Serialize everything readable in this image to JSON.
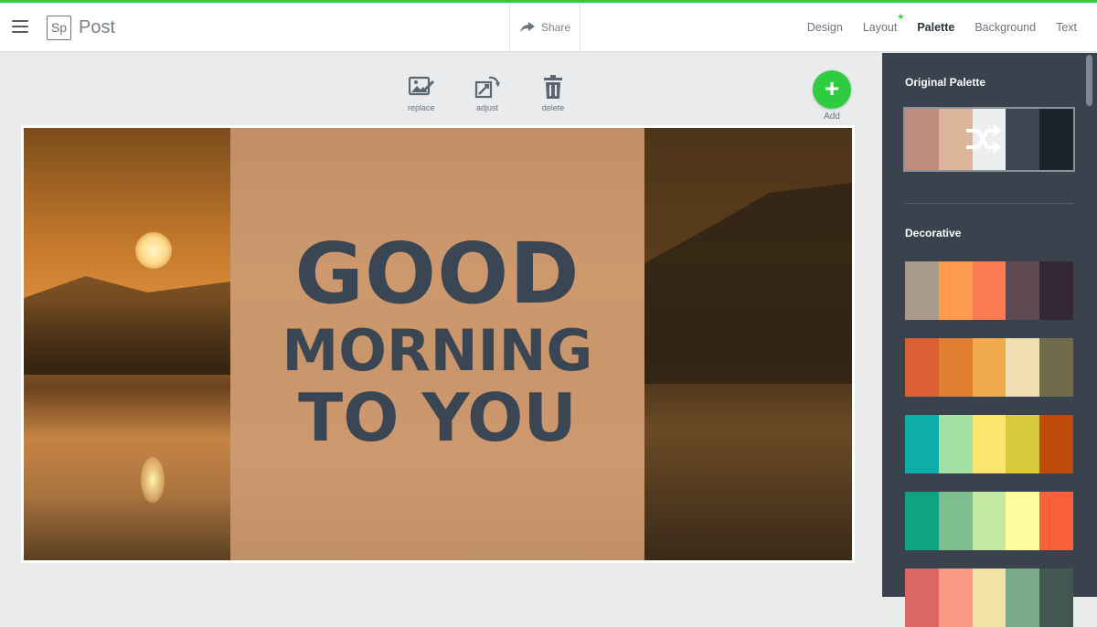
{
  "header": {
    "logo_text": "Sp",
    "app_title": "Post",
    "share_label": "Share",
    "nav": [
      {
        "label": "Design"
      },
      {
        "label": "Layout"
      },
      {
        "label": "Palette"
      },
      {
        "label": "Background"
      },
      {
        "label": "Text"
      }
    ],
    "layout_dot": "★"
  },
  "toolbar": {
    "replace_label": "replace",
    "adjust_label": "adjust",
    "delete_label": "delete",
    "add_symbol": "+",
    "add_label": "Add"
  },
  "canvas": {
    "line1": "GOOD",
    "line2": "MORNING",
    "line3": "TO YOU",
    "text_color": "#3b4654"
  },
  "sidebar": {
    "original_title": "Original Palette",
    "original_colors": [
      "#c08c7b",
      "#dcb59a",
      "#eceef0",
      "#3e4653",
      "#1c232a"
    ],
    "decorative_title": "Decorative",
    "decorative_palettes": [
      [
        "#a89b8a",
        "#ff9b4d",
        "#f87b54",
        "#5f4a52",
        "#352837"
      ],
      [
        "#dc5f33",
        "#e07f31",
        "#f2aa4e",
        "#f0dfb0",
        "#6f6b4c"
      ],
      [
        "#10aca8",
        "#a2e1a3",
        "#fee56e",
        "#d8ca3a",
        "#c14b0c"
      ],
      [
        "#0ea483",
        "#7cbe8e",
        "#c3eaa1",
        "#fdfb9c",
        "#fc5f3c"
      ],
      [
        "#dd6767",
        "#f89a84",
        "#f1e3a5",
        "#7aaa87",
        "#41574f"
      ]
    ]
  },
  "colors": {
    "accent": "#2ecc40",
    "sidebar_bg": "#39424d"
  }
}
